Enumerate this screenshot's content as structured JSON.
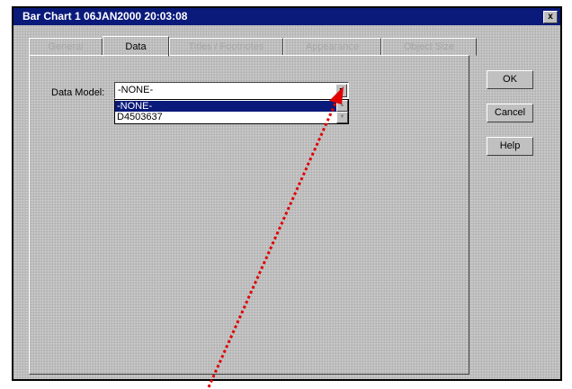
{
  "window": {
    "title": "Bar Chart 1 06JAN2000 20:03:08",
    "close_label": "x"
  },
  "tabs": [
    {
      "label": "General",
      "active": false
    },
    {
      "label": "Data",
      "active": true
    },
    {
      "label": "Titles / Footnotes",
      "active": false
    },
    {
      "label": "Appearance",
      "active": false
    },
    {
      "label": "Object Size",
      "active": false
    }
  ],
  "data_model": {
    "label": "Data Model:",
    "value": "-NONE-",
    "options": [
      "-NONE-",
      "D4503637"
    ],
    "selected_index": 0
  },
  "buttons": {
    "ok": "OK",
    "cancel": "Cancel",
    "help": "Help"
  },
  "colors": {
    "titlebar": "#0a1a7a",
    "selection": "#0a1a7a",
    "annotation_arrow": "#e00000"
  }
}
